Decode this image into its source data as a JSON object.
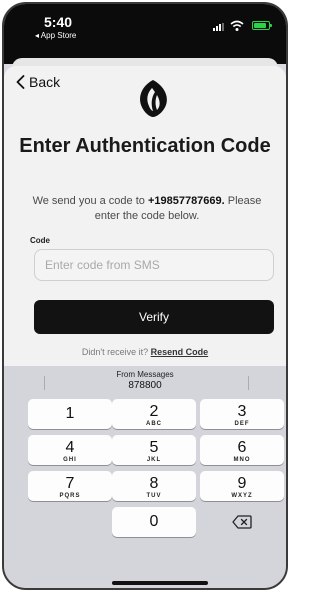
{
  "status_bar": {
    "time": "5:40",
    "back_app": "◂ App Store"
  },
  "nav": {
    "back_label": "Back"
  },
  "header": {
    "title": "Enter Authentication Code"
  },
  "message": {
    "prefix": "We send you a code to ",
    "phone": "+19857787669.",
    "suffix": " Please enter the code below."
  },
  "form": {
    "code_label": "Code",
    "code_placeholder": "Enter code from SMS",
    "code_value": "",
    "verify_label": "Verify"
  },
  "resend": {
    "prompt": "Didn't receive it? ",
    "link": "Resend Code"
  },
  "keyboard": {
    "suggestion_source": "From Messages",
    "suggestion_code": "878800",
    "keys": [
      {
        "digit": "1",
        "letters": ""
      },
      {
        "digit": "2",
        "letters": "ABC"
      },
      {
        "digit": "3",
        "letters": "DEF"
      },
      {
        "digit": "4",
        "letters": "GHI"
      },
      {
        "digit": "5",
        "letters": "JKL"
      },
      {
        "digit": "6",
        "letters": "MNO"
      },
      {
        "digit": "7",
        "letters": "PQRS"
      },
      {
        "digit": "8",
        "letters": "TUV"
      },
      {
        "digit": "9",
        "letters": "WXYZ"
      },
      {
        "digit": "0",
        "letters": ""
      }
    ],
    "delete_icon": "delete-backspace-icon"
  },
  "colors": {
    "primary_button": "#121212",
    "battery": "#2dd24a"
  }
}
